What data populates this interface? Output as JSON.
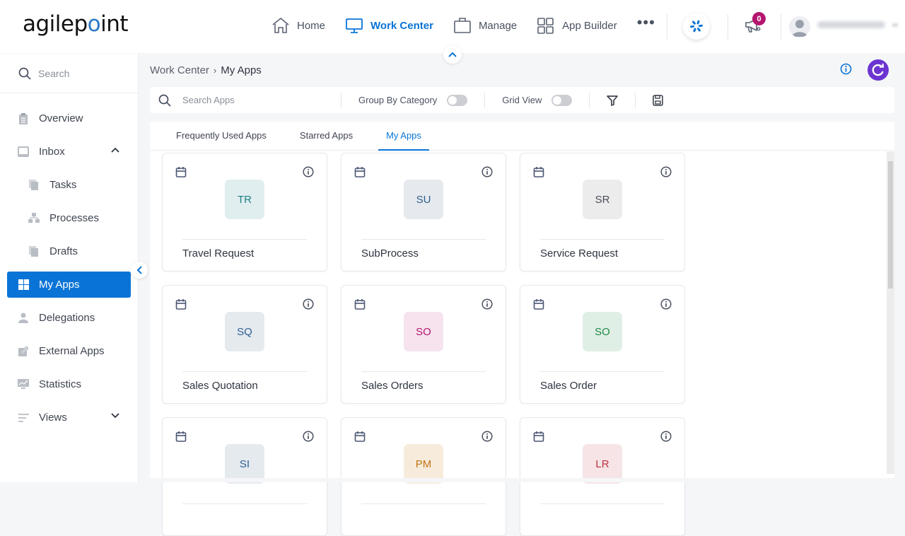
{
  "brand": {
    "logo_prefix": "agilep",
    "logo_dot": "o",
    "logo_suffix": "int",
    "accent": "#0a74d6"
  },
  "topnav": {
    "items": [
      {
        "label": "Home",
        "icon": "home-icon",
        "active": false
      },
      {
        "label": "Work Center",
        "icon": "monitor-icon",
        "active": true
      },
      {
        "label": "Manage",
        "icon": "briefcase-icon",
        "active": false
      },
      {
        "label": "App Builder",
        "icon": "grid-icon",
        "active": false
      }
    ],
    "more_label": "•••",
    "notification_count": "0"
  },
  "sidebar": {
    "search_placeholder": "Search",
    "items": [
      {
        "label": "Overview",
        "icon": "clipboard-icon"
      },
      {
        "label": "Inbox",
        "icon": "inbox-icon",
        "expanded": true
      },
      {
        "label": "Tasks",
        "icon": "tasks-icon",
        "sub": true
      },
      {
        "label": "Processes",
        "icon": "processes-icon",
        "sub": true
      },
      {
        "label": "Drafts",
        "icon": "drafts-icon",
        "sub": true
      },
      {
        "label": "My Apps",
        "icon": "apps-icon",
        "active": true
      },
      {
        "label": "Delegations",
        "icon": "person-icon"
      },
      {
        "label": "External Apps",
        "icon": "external-icon"
      },
      {
        "label": "Statistics",
        "icon": "statistics-icon"
      },
      {
        "label": "Views",
        "icon": "views-icon",
        "expanded": false
      }
    ]
  },
  "breadcrumb": {
    "parent": "Work Center",
    "separator": "›",
    "current": "My Apps"
  },
  "toolbar": {
    "search_placeholder": "Search Apps",
    "group_by_label": "Group By Category",
    "group_by_on": false,
    "grid_view_label": "Grid View",
    "grid_view_on": false
  },
  "tabs": [
    {
      "label": "Frequently Used Apps",
      "active": false
    },
    {
      "label": "Starred Apps",
      "active": false
    },
    {
      "label": "My Apps",
      "active": true
    }
  ],
  "apps": [
    {
      "initials": "TR",
      "name": "Travel Request",
      "bg": "#e0eeef",
      "fg": "#1f7f86"
    },
    {
      "initials": "SU",
      "name": "SubProcess",
      "bg": "#e6eaee",
      "fg": "#2f5f8a"
    },
    {
      "initials": "SR",
      "name": "Service Request",
      "bg": "#ececed",
      "fg": "#4a4f58"
    },
    {
      "initials": "SQ",
      "name": "Sales Quotation",
      "bg": "#e5eaef",
      "fg": "#2e6090"
    },
    {
      "initials": "SO",
      "name": "Sales Orders",
      "bg": "#f6e3ee",
      "fg": "#b3166f"
    },
    {
      "initials": "SO",
      "name": "Sales Order",
      "bg": "#e0efe5",
      "fg": "#1f8a45"
    },
    {
      "initials": "SI",
      "name": "",
      "bg": "#e5eaef",
      "fg": "#2e6090"
    },
    {
      "initials": "PM",
      "name": "",
      "bg": "#f7ecdc",
      "fg": "#c47416"
    },
    {
      "initials": "LR",
      "name": "",
      "bg": "#f6e4e6",
      "fg": "#c0343f"
    }
  ]
}
